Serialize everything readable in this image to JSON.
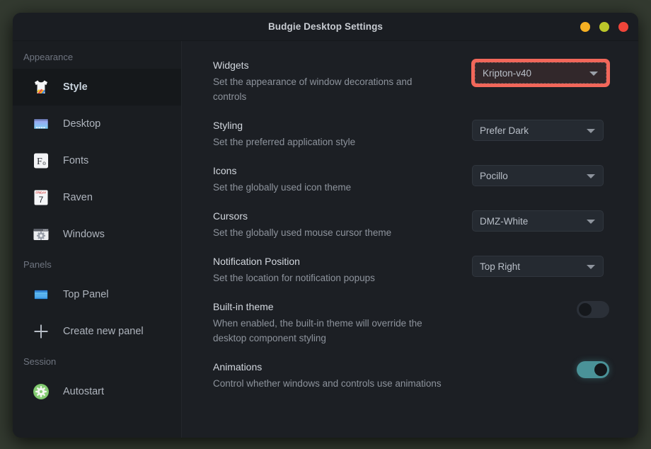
{
  "window": {
    "title": "Budgie Desktop Settings",
    "buttons": [
      {
        "name": "minimize-button",
        "label": "Minimize",
        "color": "#f6b023"
      },
      {
        "name": "maximize-button",
        "label": "Maximize",
        "color": "#bbc72a"
      },
      {
        "name": "close-button",
        "label": "Close",
        "color": "#f0453a"
      }
    ]
  },
  "sidebar": {
    "sections": [
      {
        "label": "Appearance",
        "items": [
          {
            "label": "Style",
            "icon": "tshirt-icon",
            "selected": true
          },
          {
            "label": "Desktop",
            "icon": "desktop-icon",
            "selected": false
          },
          {
            "label": "Fonts",
            "icon": "fonts-icon",
            "selected": false
          },
          {
            "label": "Raven",
            "icon": "calendar-icon",
            "selected": false
          },
          {
            "label": "Windows",
            "icon": "window-gear-icon",
            "selected": false
          }
        ]
      },
      {
        "label": "Panels",
        "items": [
          {
            "label": "Top Panel",
            "icon": "top-panel-icon",
            "selected": false
          },
          {
            "label": "Create new panel",
            "icon": "plus-icon",
            "selected": false
          }
        ]
      },
      {
        "label": "Session",
        "items": [
          {
            "label": "Autostart",
            "icon": "gear-green-icon",
            "selected": false
          }
        ]
      }
    ]
  },
  "settings": {
    "rows": [
      {
        "name": "widgets",
        "title": "Widgets",
        "desc": "Set the appearance of window decorations and controls",
        "control": "combo",
        "value": "Kripton-v40",
        "highlight": true
      },
      {
        "name": "styling",
        "title": "Styling",
        "desc": "Set the preferred application style",
        "control": "combo",
        "value": "Prefer Dark",
        "highlight": false
      },
      {
        "name": "icons",
        "title": "Icons",
        "desc": "Set the globally used icon theme",
        "control": "combo",
        "value": "Pocillo",
        "highlight": false
      },
      {
        "name": "cursors",
        "title": "Cursors",
        "desc": "Set the globally used mouse cursor theme",
        "control": "combo",
        "value": "DMZ-White",
        "highlight": false
      },
      {
        "name": "notification-position",
        "title": "Notification Position",
        "desc": "Set the location for notification popups",
        "control": "combo",
        "value": "Top Right",
        "highlight": false
      },
      {
        "name": "built-in-theme",
        "title": "Built-in theme",
        "desc": "When enabled, the built-in theme will override the desktop component styling",
        "control": "switch",
        "value": "off",
        "highlight": false
      },
      {
        "name": "animations",
        "title": "Animations",
        "desc": "Control whether windows and controls use animations",
        "control": "switch",
        "value": "on",
        "highlight": false
      }
    ]
  },
  "colors": {
    "accent_highlight": "#f2675a",
    "switch_on": "#4a9298",
    "window_bg": "#1c1f24",
    "sidebar_bg": "#1a1d21",
    "desktop_bg": "#333a30"
  }
}
